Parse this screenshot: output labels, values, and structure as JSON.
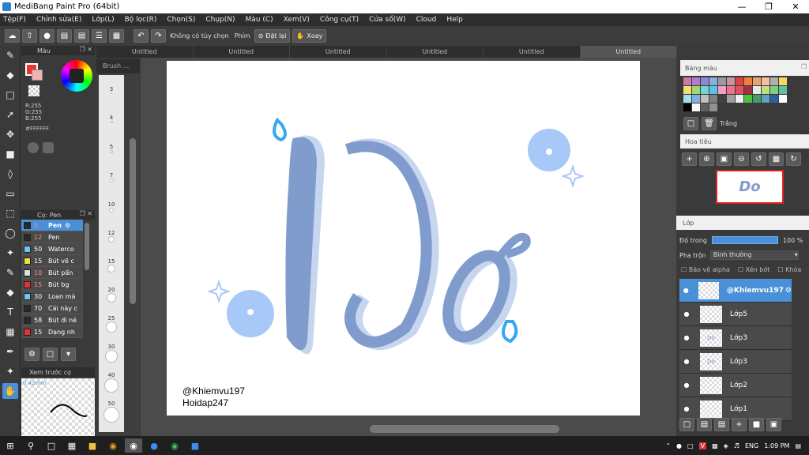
{
  "window": {
    "title": "MediBang Paint Pro (64bit)"
  },
  "menu": [
    "Tệp(F)",
    "Chỉnh sửa(E)",
    "Lớp(L)",
    "Bộ lọc(R)",
    "Chọn(S)",
    "Chụp(N)",
    "Màu (C)",
    "Xem(V)",
    "Công cụ(T)",
    "Cửa sổ(W)",
    "Cloud",
    "Help"
  ],
  "toolbar": {
    "no_option": "Không có tùy chọn",
    "key_label": "Phím",
    "reset": "Đặt lại",
    "rotate": "Xoay"
  },
  "color_panel": {
    "title": "Màu",
    "r": "R:255",
    "g": "G:255",
    "b": "B:255",
    "hex": "#FFFFFF"
  },
  "brush_panel": {
    "title": "Cọ: Pen",
    "items": [
      {
        "size": "5",
        "name": "Pen",
        "color": "#2a2a2a"
      },
      {
        "size": "12",
        "name": "Pen",
        "color": "#2a2a2a"
      },
      {
        "size": "50",
        "name": "Waterco",
        "color": "#6cc8f0"
      },
      {
        "size": "15",
        "name": "Bút vẽ c",
        "color": "#f0e040"
      },
      {
        "size": "10",
        "name": "Bút pẩn",
        "color": "#e0e0e0"
      },
      {
        "size": "15",
        "name": "Bút bg",
        "color": "#e83030"
      },
      {
        "size": "30",
        "name": "Loan mà",
        "color": "#6cc8f0"
      },
      {
        "size": "70",
        "name": "Cái này c",
        "color": "#2a2a2a"
      },
      {
        "size": "58",
        "name": "Bút đi nẻ",
        "color": "#2a2a2a"
      },
      {
        "size": "15",
        "name": "Dạng nh",
        "color": "#e83030"
      }
    ]
  },
  "preview_panel": {
    "title": "Xem trước cọ",
    "size": "0.42mm"
  },
  "size_panel": {
    "title": "Brush ...",
    "sizes": [
      "3",
      "4",
      "5",
      "7",
      "10",
      "12",
      "15",
      "20",
      "25",
      "30",
      "40",
      "50"
    ]
  },
  "tabs": [
    "Untitled",
    "Untitled",
    "Untitled",
    "Untitled",
    "Untitled",
    "Untitled"
  ],
  "canvas": {
    "art_text": "Do",
    "watermark1": "@Khiemvu197",
    "watermark2": "Hoidap247"
  },
  "palette_panel": {
    "title": "Bảng màu",
    "palette_name": "Trắng"
  },
  "navigator_panel": {
    "title": "Hoa tiêu"
  },
  "layers_panel": {
    "title": "Lớp",
    "opacity_label": "Độ trong",
    "opacity_value": "100 %",
    "blend_label": "Pha trộn",
    "blend_value": "Bình thường",
    "protect_alpha": "Bảo vệ alpha",
    "clipping": "Xén bớt",
    "lock": "Khóa",
    "layers": [
      {
        "name": "@Khiemvu197",
        "selected": true
      },
      {
        "name": "Lớp5",
        "selected": false
      },
      {
        "name": "Lớp3",
        "selected": false
      },
      {
        "name": "Lớp3",
        "selected": false
      },
      {
        "name": "Lớp2",
        "selected": false
      },
      {
        "name": "Lớp1",
        "selected": false
      }
    ]
  },
  "taskbar": {
    "lang": "ENG",
    "time": "1:09 PM"
  },
  "colors": {
    "accent": "#4a90d9",
    "art_blue": "#7f9ccc",
    "art_light": "#c6d6ee",
    "dot_blue": "#a8c8f8"
  }
}
